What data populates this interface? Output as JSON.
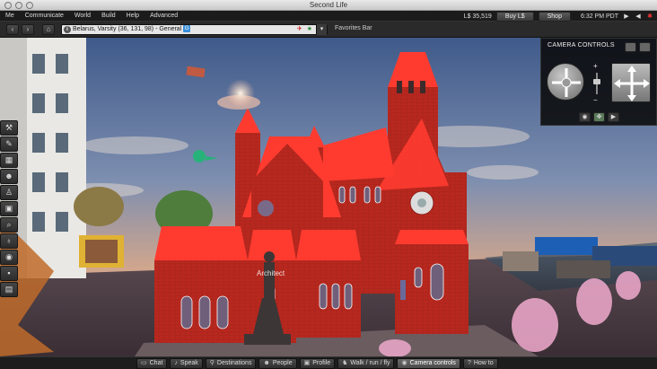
{
  "window": {
    "title": "Second Life"
  },
  "menu": {
    "items": [
      "Me",
      "Communicate",
      "World",
      "Build",
      "Help",
      "Advanced"
    ],
    "balance": "L$ 35,519",
    "buy_label": "Buy L$",
    "shop_label": "Shop",
    "clock": "6:32 PM PDT"
  },
  "nav": {
    "location": "Belarus, Varsity (36, 131, 98) - General",
    "maturity_badge": "G",
    "favorites_label": "Favorites Bar"
  },
  "camera": {
    "title": "CAMERA CONTROLS"
  },
  "scene": {
    "avatar_name": "Architect"
  },
  "bottom": {
    "buttons": [
      {
        "label": "Chat",
        "icon": "chat-bubble-icon",
        "active": false
      },
      {
        "label": "Speak",
        "icon": "microphone-icon",
        "active": false
      },
      {
        "label": "Destinations",
        "icon": "map-pin-icon",
        "active": false
      },
      {
        "label": "People",
        "icon": "people-icon",
        "active": false
      },
      {
        "label": "Profile",
        "icon": "profile-card-icon",
        "active": false
      },
      {
        "label": "Walk / run / fly",
        "icon": "walk-icon",
        "active": false
      },
      {
        "label": "Camera controls",
        "icon": "eye-icon",
        "active": true
      },
      {
        "label": "How to",
        "icon": "question-icon",
        "active": false
      }
    ]
  },
  "toolbar_icons": [
    "wrench-icon",
    "pin-icon",
    "map-icon",
    "people-icon",
    "clothing-icon",
    "inventory-icon",
    "search-icon",
    "lightbulb-icon",
    "broadcast-icon",
    "snapshot-icon",
    "chat-icon"
  ],
  "colors": {
    "accent": "#3a8fd8",
    "church": "#c62a22",
    "roof": "#ff3b30"
  }
}
